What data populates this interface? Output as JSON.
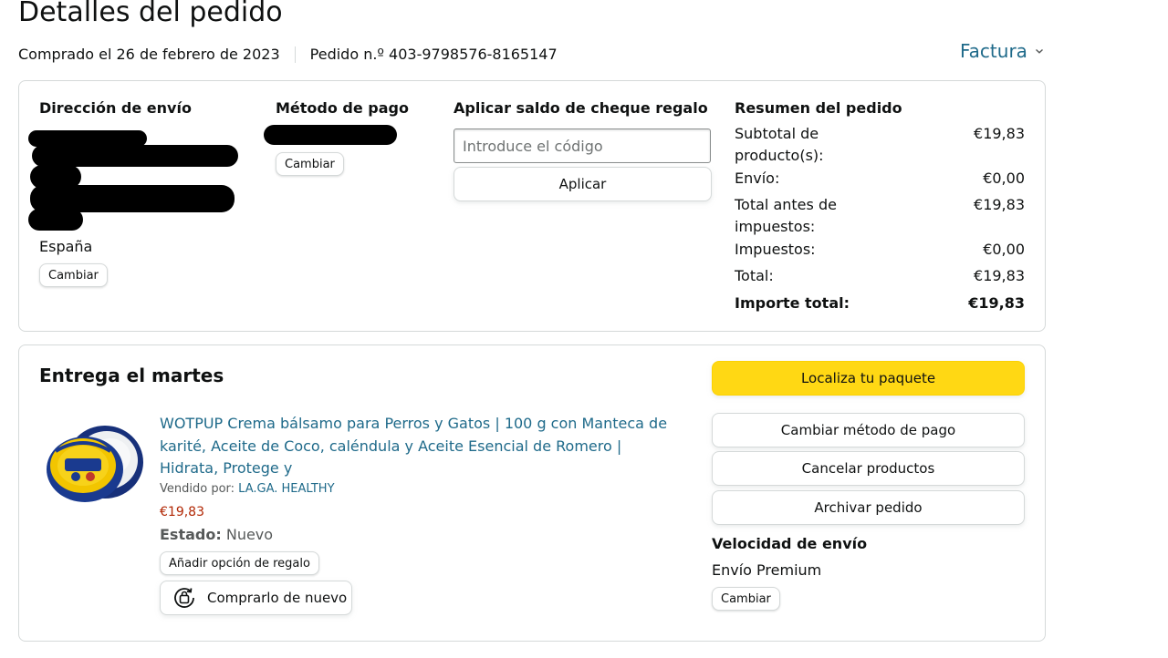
{
  "header": {
    "title": "Detalles del pedido",
    "purchased": "Comprado el 26 de febrero de 2023",
    "order_number": "Pedido n.º 403-9798576-8165147",
    "invoice_label": "Factura"
  },
  "shipping_address": {
    "heading": "Dirección de envío",
    "country": "España",
    "change_label": "Cambiar"
  },
  "payment": {
    "heading": "Método de pago",
    "change_label": "Cambiar"
  },
  "gift_card": {
    "heading": "Aplicar saldo de cheque regalo",
    "placeholder": "Introduce el código",
    "apply_label": "Aplicar"
  },
  "summary": {
    "heading": "Resumen del pedido",
    "rows": [
      {
        "label": "Subtotal de producto(s):",
        "value": "€19,83"
      },
      {
        "label": "Envío:",
        "value": "€0,00"
      },
      {
        "label": "Total antes de impuestos:",
        "value": "€19,83"
      },
      {
        "label": "Impuestos:",
        "value": "€0,00"
      },
      {
        "label": "Total:",
        "value": "€19,83"
      },
      {
        "label": "Importe total:",
        "value": "€19,83"
      }
    ]
  },
  "delivery": {
    "heading": "Entrega el martes",
    "product": {
      "title": "WOTPUP Crema bálsamo para Perros y Gatos | 100 g con Manteca de karité, Aceite de Coco, caléndula y Aceite Esencial de Romero | Hidrata, Protege y",
      "sold_by_label": "Vendido por:",
      "seller": "LA.GA. HEALTHY",
      "price": "€19,83",
      "status_label": "Estado:",
      "status_value": "Nuevo",
      "gift_option_label": "Añadir opción de regalo",
      "buy_again_label": "Comprarlo de nuevo"
    },
    "actions": {
      "track": "Localiza tu paquete",
      "change_payment": "Cambiar método de pago",
      "cancel": "Cancelar productos",
      "archive": "Archivar pedido"
    },
    "speed": {
      "heading": "Velocidad de envío",
      "value": "Envío Premium",
      "change_label": "Cambiar"
    }
  },
  "colors": {
    "link": "#1f6a8a",
    "price": "#b12704",
    "primary_button": "#ffd814",
    "border": "#d5d9d9"
  }
}
